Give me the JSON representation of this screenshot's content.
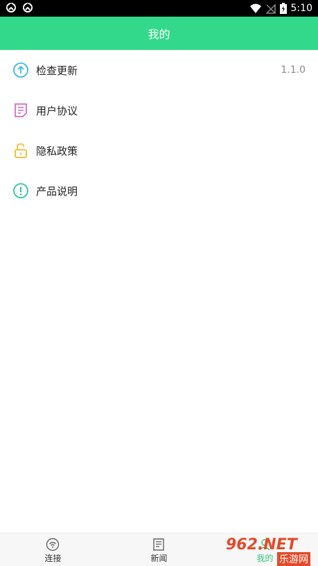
{
  "status_bar": {
    "time": "5:10"
  },
  "app_bar": {
    "title": "我的"
  },
  "menu": {
    "items": [
      {
        "label": "检查更新",
        "value": "1.1.0",
        "icon": "upload-circle-icon"
      },
      {
        "label": "用户协议",
        "icon": "document-icon"
      },
      {
        "label": "隐私政策",
        "icon": "unlock-icon"
      },
      {
        "label": "产品说明",
        "icon": "info-circle-icon"
      }
    ]
  },
  "bottom_nav": {
    "tabs": [
      {
        "label": "连接",
        "icon": "wifi-icon"
      },
      {
        "label": "新闻",
        "icon": "news-icon"
      },
      {
        "label": "我的",
        "icon": "profile-icon",
        "active": true
      }
    ]
  },
  "watermark": {
    "main": "962.NET",
    "sub": "乐游网"
  },
  "colors": {
    "accent": "#33d98a",
    "text": "#222222",
    "muted": "#8a8a8a"
  }
}
